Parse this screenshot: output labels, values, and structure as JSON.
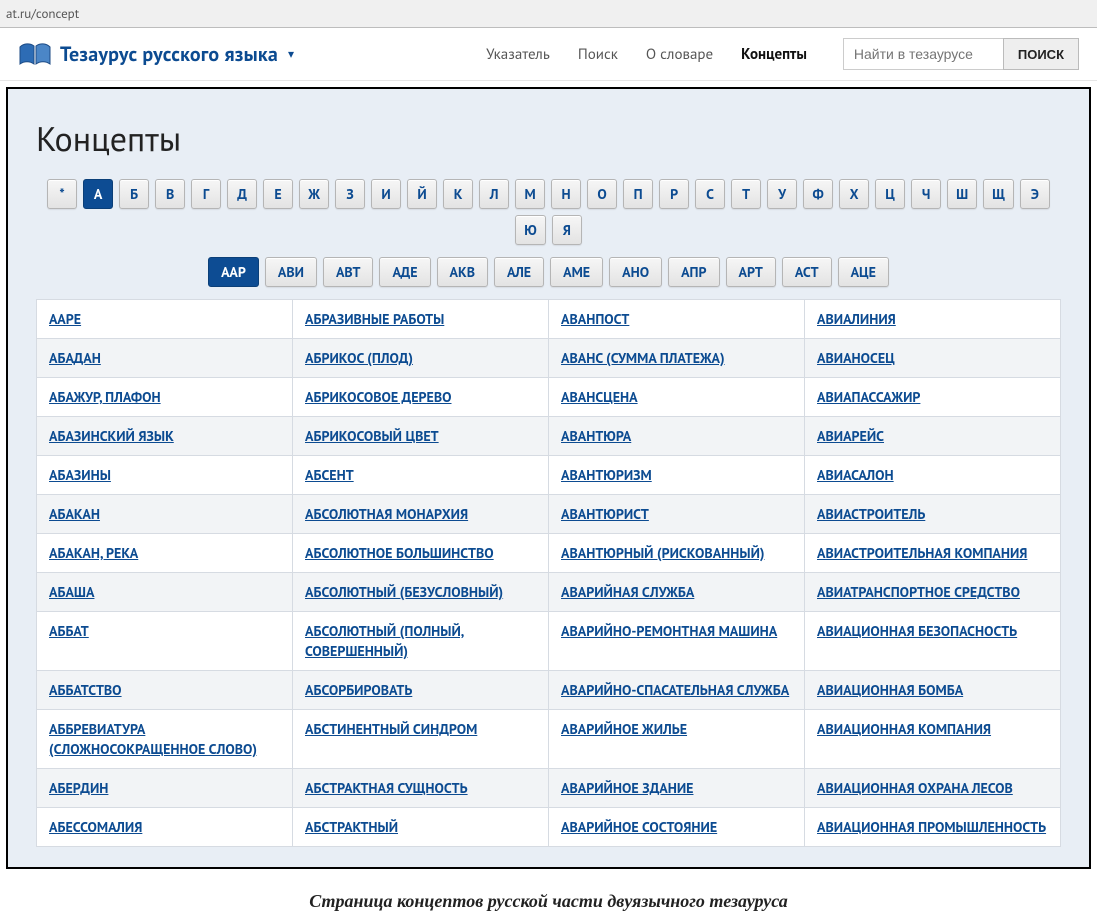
{
  "browser": {
    "url": "at.ru/concept"
  },
  "header": {
    "brand": "Тезаурус русского языка",
    "nav": [
      "Указатель",
      "Поиск",
      "О словаре",
      "Концепты"
    ],
    "active_nav_index": 3,
    "search_placeholder": "Найти в тезаурусе",
    "search_button": "ПОИСК"
  },
  "page": {
    "title": "Концепты"
  },
  "letters": [
    "*",
    "А",
    "Б",
    "В",
    "Г",
    "Д",
    "Е",
    "Ж",
    "З",
    "И",
    "Й",
    "К",
    "Л",
    "М",
    "Н",
    "О",
    "П",
    "Р",
    "С",
    "Т",
    "У",
    "Ф",
    "Х",
    "Ц",
    "Ч",
    "Ш",
    "Щ",
    "Э",
    "Ю",
    "Я"
  ],
  "active_letter_index": 1,
  "syllables": [
    "ААР",
    "АВИ",
    "АВТ",
    "АДЕ",
    "АКВ",
    "АЛЕ",
    "АМЕ",
    "АНО",
    "АПР",
    "АРТ",
    "АСТ",
    "АЦЕ"
  ],
  "active_syllable_index": 0,
  "concepts": {
    "col1": [
      "ААРЕ",
      "АБАДАН",
      "АБАЖУР, ПЛАФОН",
      "АБАЗИНСКИЙ ЯЗЫК",
      "АБАЗИНЫ",
      "АБАКАН",
      "АБАКАН, РЕКА",
      "АБАША",
      "АББАТ",
      "АББАТСТВО",
      "АББРЕВИАТУРА (СЛОЖНОСОКРАЩЕННОЕ СЛОВО)",
      "АБЕРДИН",
      "АБЕССОМАЛИЯ"
    ],
    "col2": [
      "АБРАЗИВНЫЕ РАБОТЫ",
      "АБРИКОС (ПЛОД)",
      "АБРИКОСОВОЕ ДЕРЕВО",
      "АБРИКОСОВЫЙ ЦВЕТ",
      "АБСЕНТ",
      "АБСОЛЮТНАЯ МОНАРХИЯ",
      "АБСОЛЮТНОЕ БОЛЬШИНСТВО",
      "АБСОЛЮТНЫЙ (БЕЗУСЛОВНЫЙ)",
      "АБСОЛЮТНЫЙ (ПОЛНЫЙ, СОВЕРШЕННЫЙ)",
      "АБСОРБИРОВАТЬ",
      "АБСТИНЕНТНЫЙ СИНДРОМ",
      "АБСТРАКТНАЯ СУЩНОСТЬ",
      "АБСТРАКТНЫЙ"
    ],
    "col3": [
      "АВАНПОСТ",
      "АВАНС (СУММА ПЛАТЕЖА)",
      "АВАНСЦЕНА",
      "АВАНТЮРА",
      "АВАНТЮРИЗМ",
      "АВАНТЮРИСТ",
      "АВАНТЮРНЫЙ (РИСКОВАННЫЙ)",
      "АВАРИЙНАЯ СЛУЖБА",
      "АВАРИЙНО-РЕМОНТНАЯ МАШИНА",
      "АВАРИЙНО-СПАСАТЕЛЬНАЯ СЛУЖБА",
      "АВАРИЙНОЕ ЖИЛЬЕ",
      "АВАРИЙНОЕ ЗДАНИЕ",
      "АВАРИЙНОЕ СОСТОЯНИЕ"
    ],
    "col4": [
      "АВИАЛИНИЯ",
      "АВИАНОСЕЦ",
      "АВИАПАССАЖИР",
      "АВИАРЕЙС",
      "АВИАСАЛОН",
      "АВИАСТРОИТЕЛЬ",
      "АВИАСТРОИТЕЛЬНАЯ КОМПАНИЯ",
      "АВИАТРАНСПОРТНОЕ СРЕДСТВО",
      "АВИАЦИОННАЯ БЕЗОПАСНОСТЬ",
      "АВИАЦИОННАЯ БОМБА",
      "АВИАЦИОННАЯ КОМПАНИЯ",
      "АВИАЦИОННАЯ ОХРАНА ЛЕСОВ",
      "АВИАЦИОННАЯ ПРОМЫШЛЕННОСТЬ"
    ]
  },
  "caption": "Страница концептов русской части двуязычного тезауруса"
}
